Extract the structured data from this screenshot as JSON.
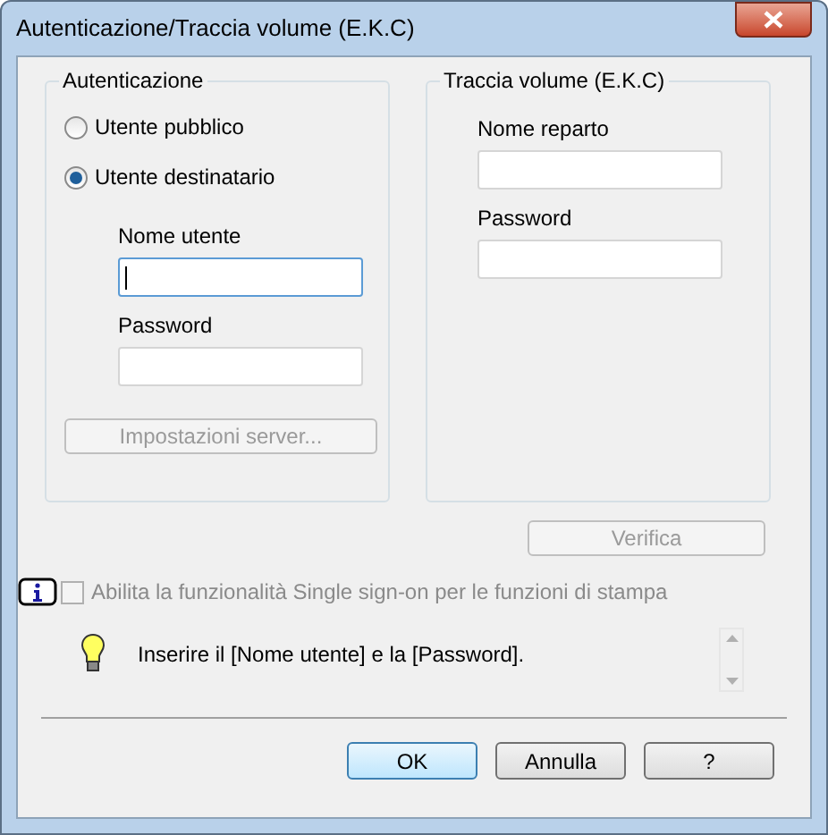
{
  "window": {
    "title": "Autenticazione/Traccia volume (E.K.C)"
  },
  "authentication": {
    "title": "Autenticazione",
    "radios": [
      {
        "label": "Utente pubblico",
        "selected": false
      },
      {
        "label": "Utente destinatario",
        "selected": true
      }
    ],
    "fields": [
      {
        "label": "Nome utente",
        "focused": true
      },
      {
        "label": "Password",
        "focused": false
      }
    ],
    "server_button": {
      "label": "Impostazioni server...",
      "disabled": true
    }
  },
  "volume_tracking": {
    "title": "Traccia volume (E.K.C)",
    "fields": [
      {
        "label": "Nome reparto",
        "focused": false
      },
      {
        "label": "Password",
        "focused": false
      }
    ]
  },
  "verify_button": {
    "label": "Verifica",
    "disabled": true
  },
  "single_sign_on": {
    "label": "Abilita la funzionalità Single sign-on per le funzioni di stampa",
    "checked": false,
    "disabled": true
  },
  "hint": {
    "text": "Inserire il [Nome utente] e la [Password]."
  },
  "buttons": [
    {
      "label": "OK",
      "default": true
    },
    {
      "label": "Annulla",
      "default": false
    },
    {
      "label": "?",
      "default": false
    }
  ]
}
